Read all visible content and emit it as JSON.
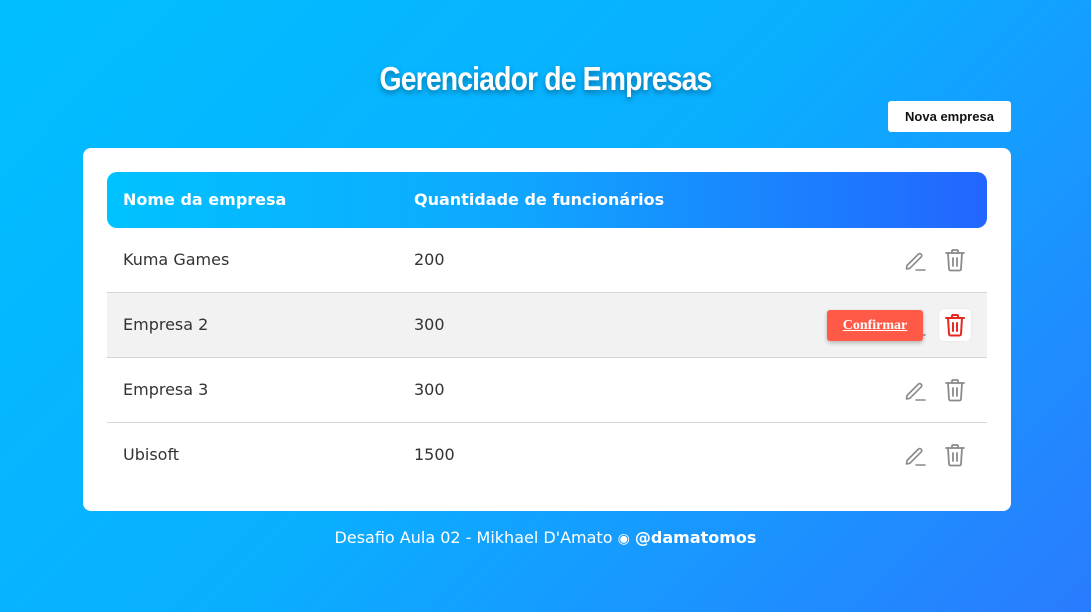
{
  "page": {
    "title": "Gerenciador de Empresas",
    "new_button_label": "Nova empresa"
  },
  "table": {
    "headers": {
      "name": "Nome da empresa",
      "quantity": "Quantidade de funcionários"
    },
    "rows": [
      {
        "name": "Kuma Games",
        "quantity": "200",
        "confirm_visible": false
      },
      {
        "name": "Empresa 2",
        "quantity": "300",
        "confirm_visible": true,
        "confirm_label": "Confirmar"
      },
      {
        "name": "Empresa 3",
        "quantity": "300",
        "confirm_visible": false
      },
      {
        "name": "Ubisoft",
        "quantity": "1500",
        "confirm_visible": false
      }
    ]
  },
  "footer": {
    "text": "Desafio Aula 02 - Mikhael D'Amato",
    "separator": "◉",
    "handle": "@damatomos"
  },
  "icons": {
    "edit": "pencil-icon",
    "delete": "trash-icon"
  },
  "colors": {
    "background_start": "#00bfff",
    "background_end": "#2a7bff",
    "header_gradient_start": "#00c2ff",
    "header_gradient_end": "#2366ff",
    "confirm": "#ff5a47",
    "delete_active": "#e8281f",
    "icon_default": "#8a8a8a"
  }
}
